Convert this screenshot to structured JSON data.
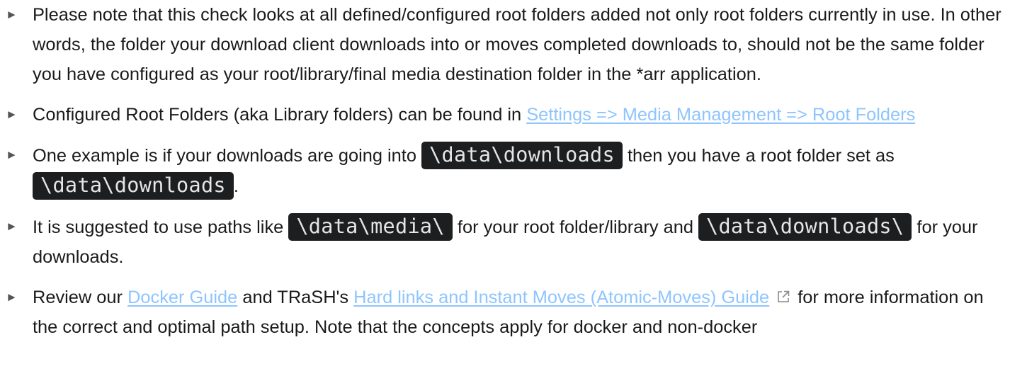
{
  "items": [
    {
      "text": "Please note that this check looks at all defined/configured root folders added not only root folders currently in use. In other words, the folder your download client downloads into or moves completed downloads to, should not be the same folder you have configured as your root/library/final media destination folder in the *arr application."
    },
    {
      "text_before": "Configured Root Folders (aka Library folders) can be found in ",
      "link": "Settings => Media Management => Root Folders"
    },
    {
      "text_before": "One example is if your downloads are going into ",
      "code1": "\\data\\downloads",
      "text_middle": " then you have a root folder set as ",
      "code2": "\\data\\downloads",
      "text_after": "."
    },
    {
      "text_before": "It is suggested to use paths like ",
      "code1": "\\data\\media\\",
      "text_middle": " for your root folder/library and ",
      "code2": "\\data\\downloads\\",
      "text_after": " for your downloads."
    },
    {
      "text_before": "Review our ",
      "link1": "Docker Guide",
      "text_middle": " and TRaSH's ",
      "link2": "Hard links and Instant Moves (Atomic-Moves) Guide",
      "icon": "external-link-icon",
      "text_after": "for more information on the correct and optimal path setup. Note that the concepts apply for docker and non-docker"
    }
  ],
  "marker": "►",
  "colors": {
    "link": "#8ec5ff",
    "code_bg": "#1d1e20",
    "code_text": "#e6e6e6",
    "text": "#1a1a1a"
  }
}
